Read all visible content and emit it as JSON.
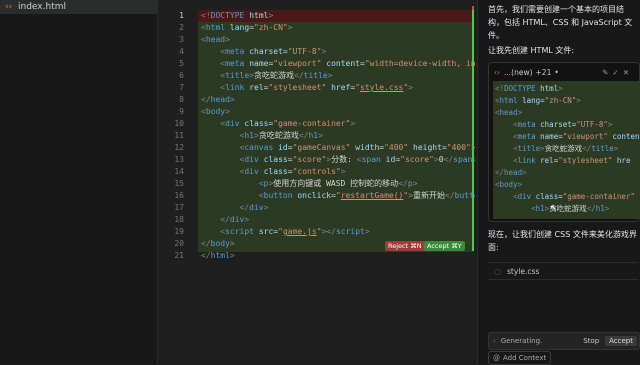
{
  "file_tree": {
    "open_file": "index.html",
    "file_icon": "code-brackets-icon"
  },
  "editor": {
    "current_line": "1",
    "reject_label": "Reject ⌘N",
    "accept_label": "Accept ⌘Y"
  },
  "chat": {
    "intro": "首先，我们需要创建一个基本的项目结构，包括 HTML、CSS 和 JavaScript 文件。",
    "step1": "让我先创建 HTML 文件:",
    "card": {
      "filename": "...(new)",
      "diff_count": "+21",
      "dot": "•"
    },
    "step2": "现在，让我们创建 CSS 文件来美化游戏界面:",
    "pending_file": "style.css",
    "status": "Generating.",
    "stop_label": "Stop",
    "accept_label": "Accept",
    "add_context_label": "Add Context"
  },
  "colors": {
    "added_bg": "#2d3a23",
    "removed_bg": "#4b1818",
    "accept": "#3c8a3c",
    "reject": "#a33a3a",
    "file_icon": "#e37933"
  }
}
